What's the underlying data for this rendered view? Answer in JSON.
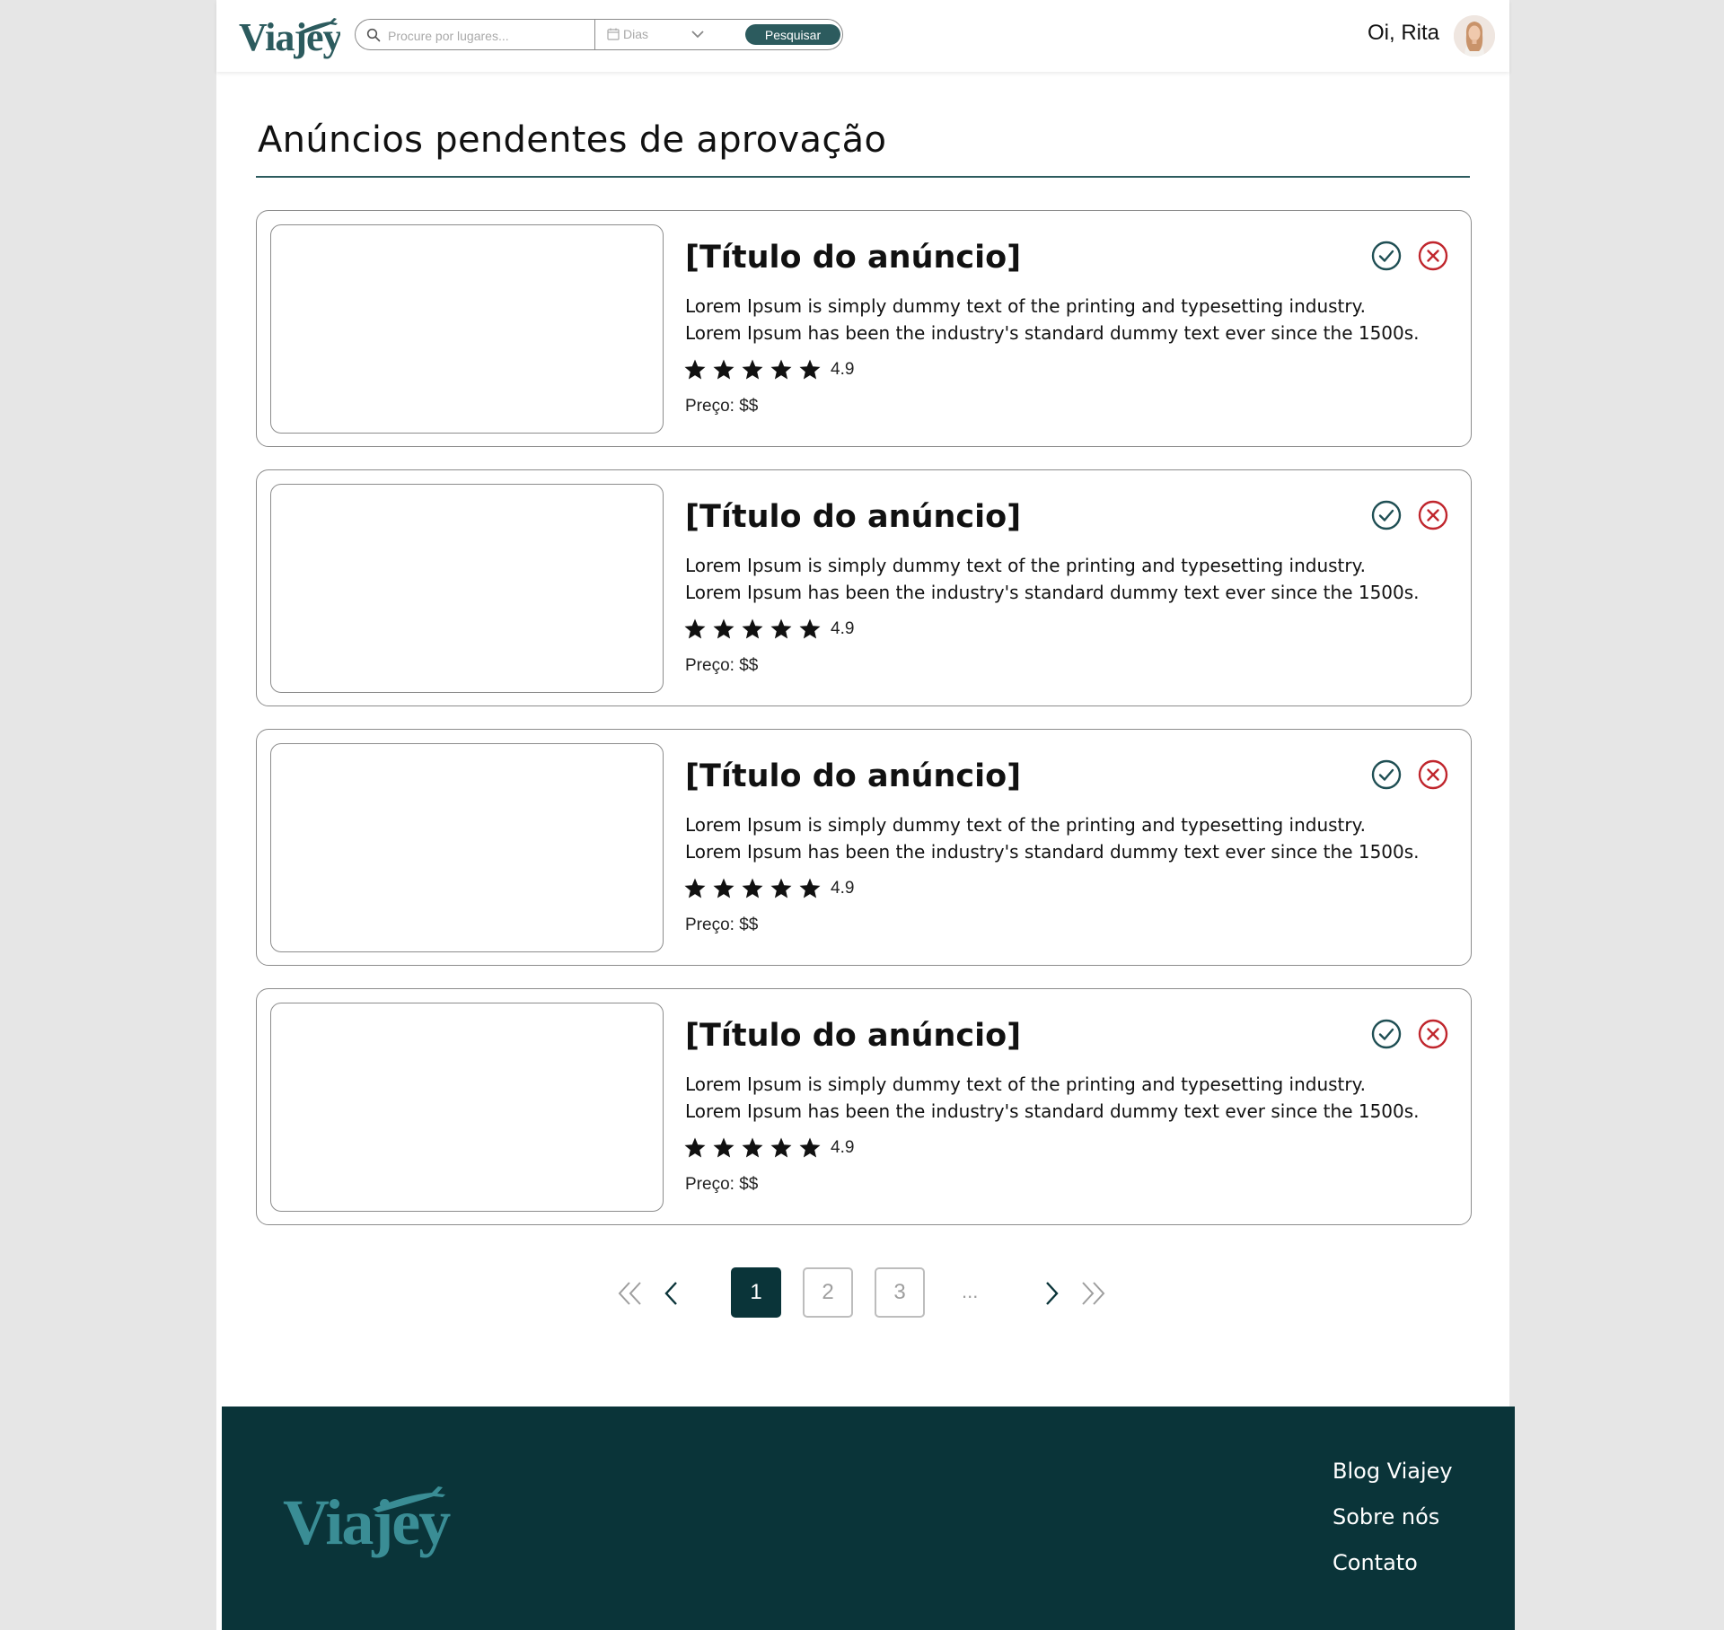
{
  "header": {
    "brand": "Viajey",
    "search": {
      "placeholder": "Procure por lugares...",
      "days_label": "Dias",
      "button_label": "Pesquisar"
    },
    "greeting": "Oi, Rita"
  },
  "main": {
    "title": "Anúncios pendentes de aprovação",
    "listings": [
      {
        "title": "[Título do anúncio]",
        "desc_line1": "Lorem Ipsum is simply dummy text of the printing and  typesetting industry.",
        "desc_line2": "Lorem Ipsum has been the industry's standard dummy text ever since the 1500s.",
        "rating": "4.9",
        "stars": 5,
        "price": "Preço: $$"
      },
      {
        "title": "[Título do anúncio]",
        "desc_line1": "Lorem Ipsum is simply dummy text of the printing and  typesetting industry.",
        "desc_line2": "Lorem Ipsum has been the industry's standard dummy text ever since the 1500s.",
        "rating": "4.9",
        "stars": 5,
        "price": "Preço: $$"
      },
      {
        "title": "[Título do anúncio]",
        "desc_line1": "Lorem Ipsum is simply dummy text of the printing and  typesetting industry.",
        "desc_line2": "Lorem Ipsum has been the industry's standard dummy text ever since the 1500s.",
        "rating": "4.9",
        "stars": 5,
        "price": "Preço: $$"
      },
      {
        "title": "[Título do anúncio]",
        "desc_line1": "Lorem Ipsum is simply dummy text of the printing and  typesetting industry.",
        "desc_line2": "Lorem Ipsum has been the industry's standard dummy text ever since the 1500s.",
        "rating": "4.9",
        "stars": 5,
        "price": "Preço: $$"
      }
    ]
  },
  "pagination": {
    "pages": [
      "1",
      "2",
      "3"
    ],
    "current": "1",
    "ellipsis": "..."
  },
  "footer": {
    "brand": "Viajey",
    "links": [
      "Blog Viajey",
      "Sobre nós",
      "Contato"
    ]
  },
  "colors": {
    "brand": "#2c5b5e",
    "footer_bg": "#0a3439",
    "approve": "#1f4f54",
    "reject": "#c0262d",
    "logo_light": "#3a8d95"
  },
  "icons": [
    "search-icon",
    "calendar-icon",
    "chevron-down-icon",
    "star-icon",
    "check-circle-icon",
    "x-circle-icon",
    "double-chevron-left-icon",
    "chevron-left-icon",
    "chevron-right-icon",
    "double-chevron-right-icon",
    "airplane-icon"
  ]
}
